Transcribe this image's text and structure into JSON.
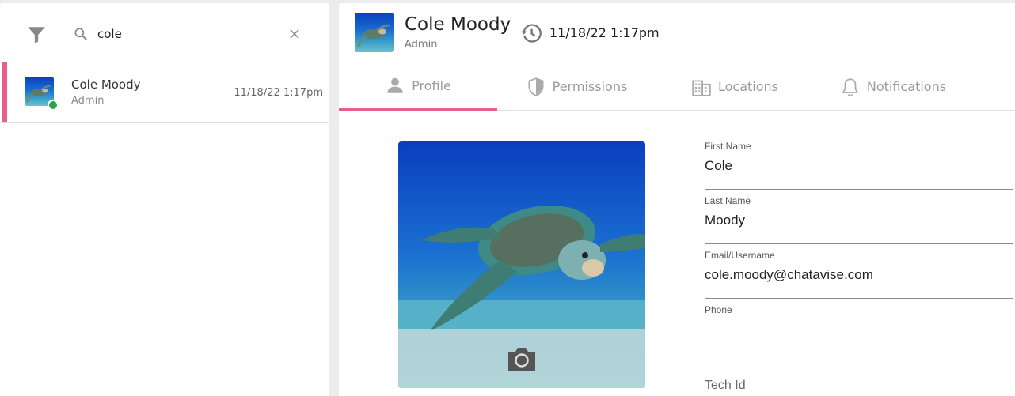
{
  "search": {
    "value": "cole"
  },
  "contacts": [
    {
      "name": "Cole Moody",
      "role": "Admin",
      "time": "11/18/22 1:17pm",
      "status": "online"
    }
  ],
  "header": {
    "name": "Cole Moody",
    "role": "Admin",
    "time": "11/18/22 1:17pm"
  },
  "tabs": [
    {
      "label": "Profile",
      "icon": "person-icon",
      "active": true
    },
    {
      "label": "Permissions",
      "icon": "shield-icon",
      "active": false
    },
    {
      "label": "Locations",
      "icon": "building-icon",
      "active": false
    },
    {
      "label": "Notifications",
      "icon": "bell-icon",
      "active": false
    }
  ],
  "profile": {
    "fields": [
      {
        "label": "First Name",
        "value": "Cole"
      },
      {
        "label": "Last Name",
        "value": "Moody"
      },
      {
        "label": "Email/Username",
        "value": "cole.moody@chatavise.com"
      },
      {
        "label": "Phone",
        "value": ""
      }
    ],
    "tech_id_label": "Tech Id"
  },
  "colors": {
    "accent": "#e85f8e",
    "online": "#2aa44a"
  }
}
